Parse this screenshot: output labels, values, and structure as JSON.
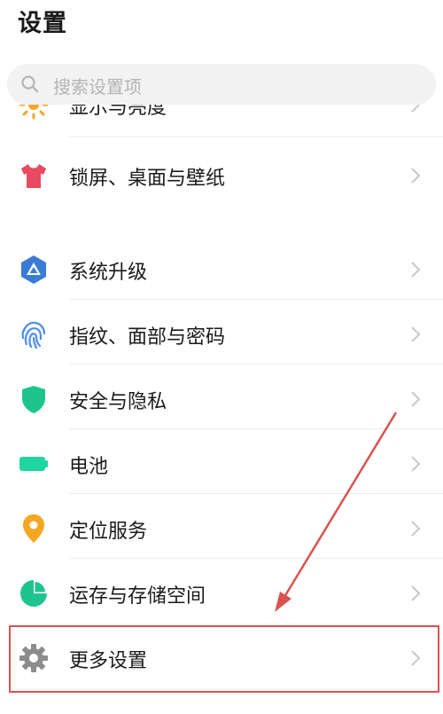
{
  "header": {
    "title": "设置"
  },
  "search": {
    "placeholder": "搜索设置项",
    "icon": "search-icon"
  },
  "settings": {
    "partial_item": {
      "label": "显示与亮度",
      "icon": "sun-icon",
      "color": "#f5a623"
    },
    "items": [
      {
        "label": "锁屏、桌面与壁纸",
        "icon": "tshirt-icon",
        "color": "#e84a5f"
      },
      {
        "label": "系统升级",
        "icon": "system-update-icon",
        "color": "#3a7bd5"
      },
      {
        "label": "指纹、面部与密码",
        "icon": "fingerprint-icon",
        "color": "#4a8cf0"
      },
      {
        "label": "安全与隐私",
        "icon": "shield-icon",
        "color": "#1fc48d"
      },
      {
        "label": "电池",
        "icon": "battery-icon",
        "color": "#1fd6a0"
      },
      {
        "label": "定位服务",
        "icon": "location-pin-icon",
        "color": "#f5a623"
      },
      {
        "label": "运存与存储空间",
        "icon": "pie-chart-icon",
        "color": "#1fc48d"
      },
      {
        "label": "更多设置",
        "icon": "gear-icon",
        "color": "#8c8c8c"
      }
    ]
  },
  "annotation": {
    "color": "#d9534f"
  }
}
